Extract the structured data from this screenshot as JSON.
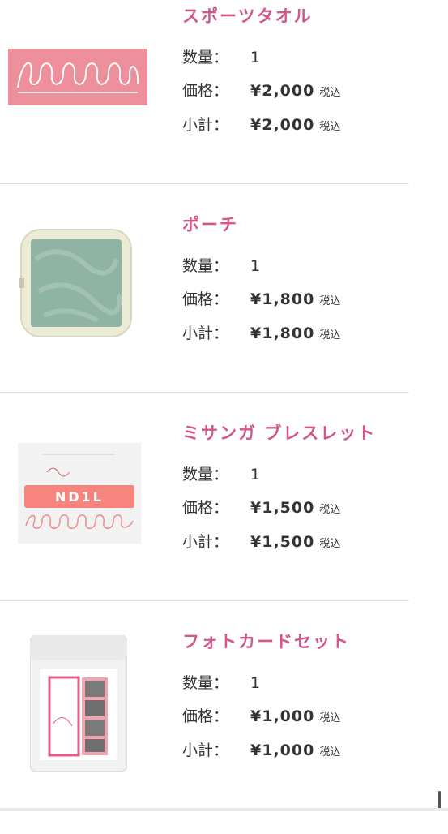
{
  "labels": {
    "qty": "数量：",
    "price": "価格：",
    "subtotal": "小計：",
    "tax": "税込"
  },
  "items": [
    {
      "name": "スポーツタオル",
      "qty": "1",
      "price": "¥2,000",
      "subtotal": "¥2,000",
      "thumb_icon": "towel-image"
    },
    {
      "name": "ポーチ",
      "qty": "1",
      "price": "¥1,800",
      "subtotal": "¥1,800",
      "thumb_icon": "pouch-image"
    },
    {
      "name": "ミサンガ ブレスレット",
      "qty": "1",
      "price": "¥1,500",
      "subtotal": "¥1,500",
      "thumb_icon": "bracelet-image",
      "thumb_text": "ND1L"
    },
    {
      "name": "フォトカードセット",
      "qty": "1",
      "price": "¥1,000",
      "subtotal": "¥1,000",
      "thumb_icon": "photocard-image"
    }
  ],
  "colors": {
    "accent": "#d2578a",
    "text": "#333333",
    "divider": "#e3e3e3"
  }
}
